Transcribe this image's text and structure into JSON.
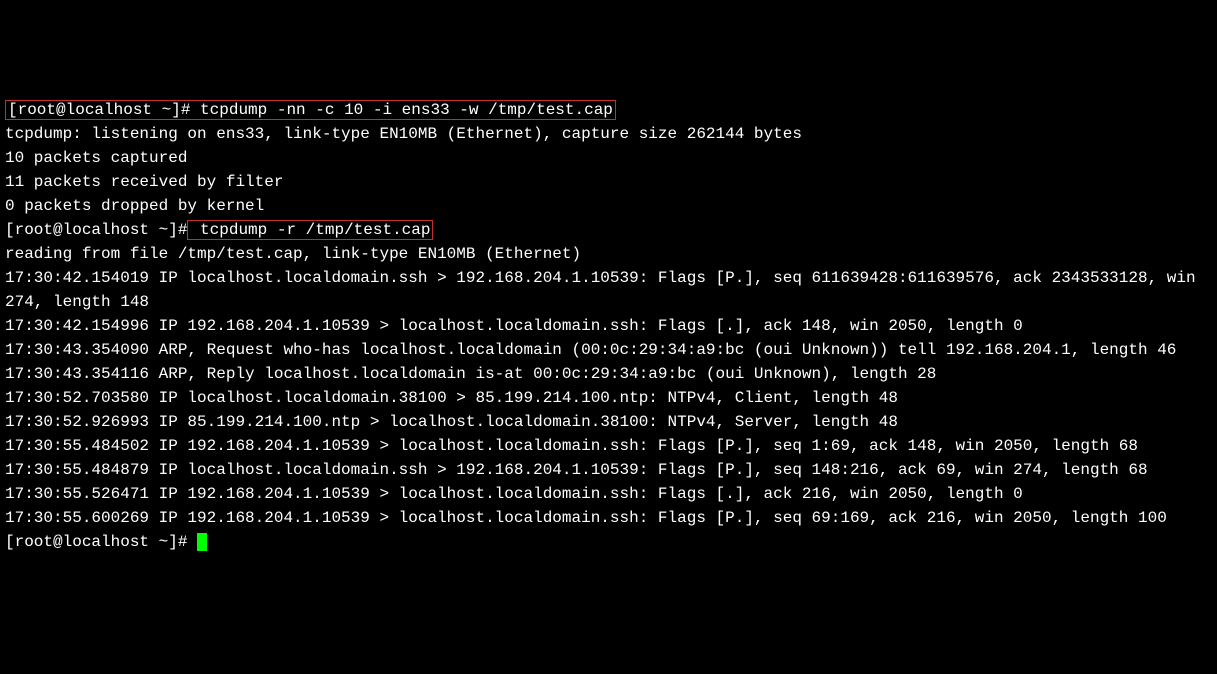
{
  "prompt1_prefix": "[root@localhost ~]#",
  "cmd1": " tcpdump -nn -c 10 -i ens33 -w /tmp/test.cap",
  "out1": "tcpdump: listening on ens33, link-type EN10MB (Ethernet), capture size 262144 bytes",
  "out2": "10 packets captured",
  "out3": "11 packets received by filter",
  "out4": "0 packets dropped by kernel",
  "prompt2_prefix": "[root@localhost ~]#",
  "cmd2": " tcpdump -r /tmp/test.cap",
  "r0": "reading from file /tmp/test.cap, link-type EN10MB (Ethernet)",
  "r1": "17:30:42.154019 IP localhost.localdomain.ssh > 192.168.204.1.10539: Flags [P.], seq 611639428:611639576, ack 2343533128, win 274, length 148",
  "r2": "17:30:42.154996 IP 192.168.204.1.10539 > localhost.localdomain.ssh: Flags [.], ack 148, win 2050, length 0",
  "r3": "17:30:43.354090 ARP, Request who-has localhost.localdomain (00:0c:29:34:a9:bc (oui Unknown)) tell 192.168.204.1, length 46",
  "r4": "17:30:43.354116 ARP, Reply localhost.localdomain is-at 00:0c:29:34:a9:bc (oui Unknown), length 28",
  "r5": "17:30:52.703580 IP localhost.localdomain.38100 > 85.199.214.100.ntp: NTPv4, Client, length 48",
  "r6": "17:30:52.926993 IP 85.199.214.100.ntp > localhost.localdomain.38100: NTPv4, Server, length 48",
  "r7": "17:30:55.484502 IP 192.168.204.1.10539 > localhost.localdomain.ssh: Flags [P.], seq 1:69, ack 148, win 2050, length 68",
  "r8": "17:30:55.484879 IP localhost.localdomain.ssh > 192.168.204.1.10539: Flags [P.], seq 148:216, ack 69, win 274, length 68",
  "r9": "17:30:55.526471 IP 192.168.204.1.10539 > localhost.localdomain.ssh: Flags [.], ack 216, win 2050, length 0",
  "r10": "17:30:55.600269 IP 192.168.204.1.10539 > localhost.localdomain.ssh: Flags [P.], seq 69:169, ack 216, win 2050, length 100",
  "prompt3_prefix": "[root@localhost ~]# "
}
